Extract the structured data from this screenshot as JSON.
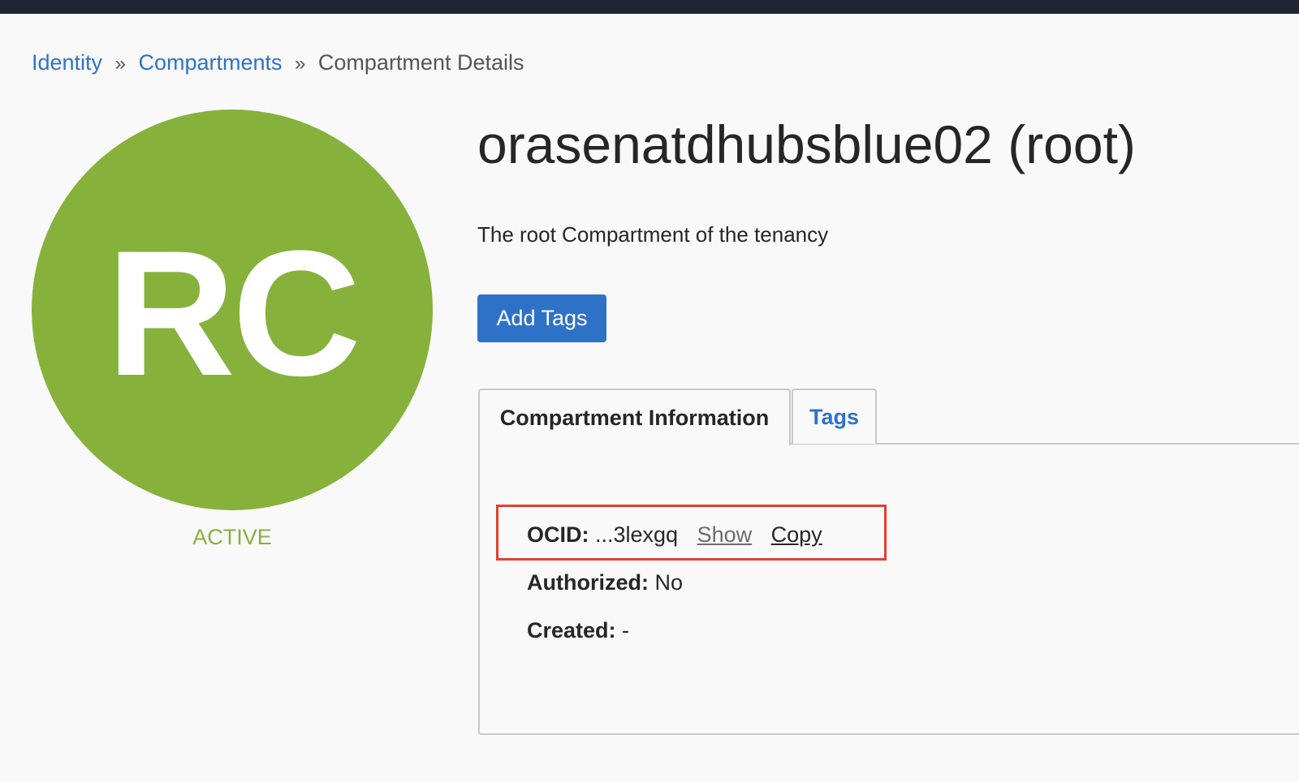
{
  "breadcrumb": {
    "items": [
      "Identity",
      "Compartments"
    ],
    "separator": "»",
    "current": "Compartment Details"
  },
  "avatar": {
    "initials": "RC",
    "color": "#86b23c"
  },
  "status": "ACTIVE",
  "title": "orasenatdhubsblue02 (root)",
  "description": "The root Compartment of the tenancy",
  "actions": {
    "add_tags": "Add Tags"
  },
  "tabs": [
    {
      "label": "Compartment Information",
      "active": true
    },
    {
      "label": "Tags",
      "active": false
    }
  ],
  "info": {
    "ocid_label": "OCID:",
    "ocid_value": "...3lexgq",
    "show_link": "Show",
    "copy_link": "Copy",
    "authorized_label": "Authorized:",
    "authorized_value": "No",
    "created_label": "Created:",
    "created_value": "-"
  },
  "colors": {
    "accent": "#2e72c8",
    "status_green": "#86b23c",
    "highlight": "#e2402e",
    "topbar": "#1f2532"
  }
}
